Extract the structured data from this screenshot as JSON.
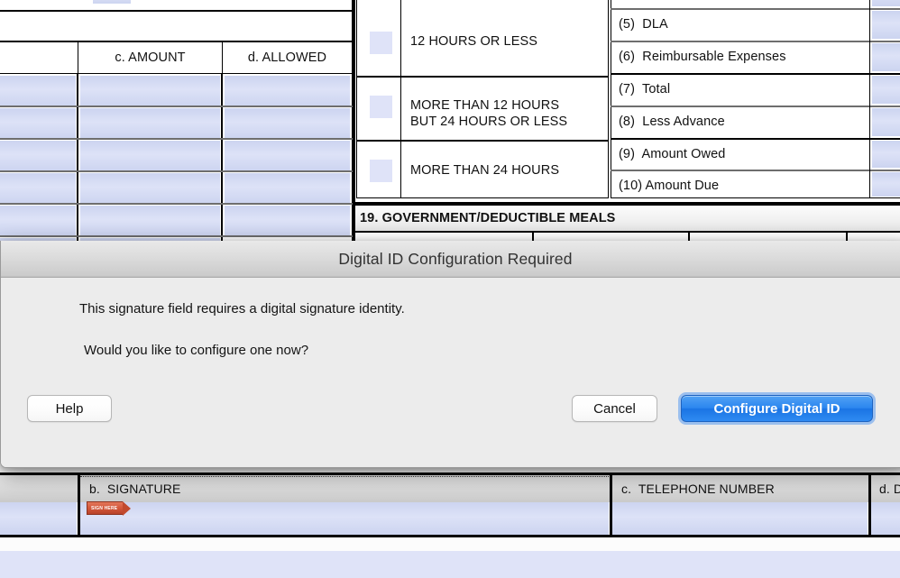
{
  "document": {
    "form_background": {
      "left_table": {
        "column_headers": [
          "c. AMOUNT",
          "d. ALLOWED"
        ]
      },
      "duration_options": [
        "12 HOURS OR LESS",
        "MORE THAN 12 HOURS\nBUT 24 HOURS OR LESS",
        "MORE THAN 24 HOURS"
      ],
      "amount_rows": [
        "(5)  DLA",
        "(6)  Reimbursable Expenses",
        "(7)  Total",
        "(8)  Less Advance",
        "(9)  Amount Owed",
        "(10) Amount Due"
      ],
      "section_19_header": "19. GOVERNMENT/DEDUCTIBLE MEALS",
      "signature_row": {
        "signature_label": "b.  SIGNATURE",
        "telephone_label": "c.  TELEPHONE NUMBER",
        "date_label": "d. D",
        "sign_here_tag": "SIGN HERE"
      }
    }
  },
  "dialog": {
    "title": "Digital ID Configuration Required",
    "line1": "This signature field requires a digital signature identity.",
    "line2": "Would you like to configure one now?",
    "buttons": {
      "help": "Help",
      "cancel": "Cancel",
      "configure": "Configure Digital ID"
    }
  },
  "colors": {
    "accent_button": "#2b86ef",
    "form_field": "#dfe3f8",
    "dialog_background": "#ececec",
    "sign_here_tag": "#c24a2e"
  }
}
